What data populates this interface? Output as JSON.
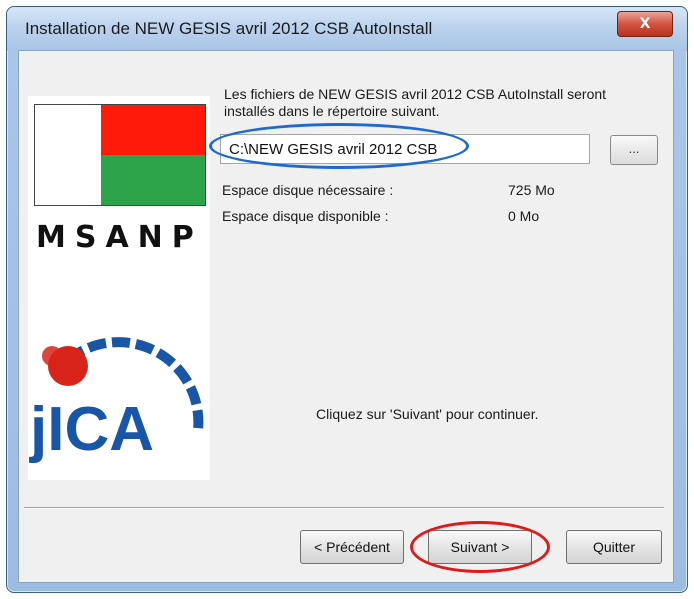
{
  "window": {
    "title": "Installation de NEW GESIS avril 2012 CSB AutoInstall",
    "close_symbol": "x"
  },
  "logos": {
    "msanp_text": "MSANP",
    "jica_text": "JICA",
    "flag_colors": {
      "white": "#ffffff",
      "red": "#ff1a0a",
      "green": "#2ea44a"
    },
    "jica_red": "#d8241a",
    "jica_blue": "#1a56a8"
  },
  "install": {
    "description": "Les fichiers de NEW GESIS avril 2012 CSB AutoInstall seront installés dans le répertoire suivant.",
    "path_value": "C:\\NEW GESIS avril 2012 CSB",
    "browse_label": "...",
    "space_required_label": "Espace disque nécessaire :",
    "space_required_value": "725 Mo",
    "space_available_label": "Espace disque disponible :",
    "space_available_value": "0 Mo",
    "hint": "Cliquez sur 'Suivant' pour continuer."
  },
  "buttons": {
    "previous": "< Précédent",
    "next": "Suivant >",
    "quit": "Quitter"
  },
  "annotations": {
    "path_circle_color": "#1f6ad0",
    "next_circle_color": "#e01919"
  }
}
